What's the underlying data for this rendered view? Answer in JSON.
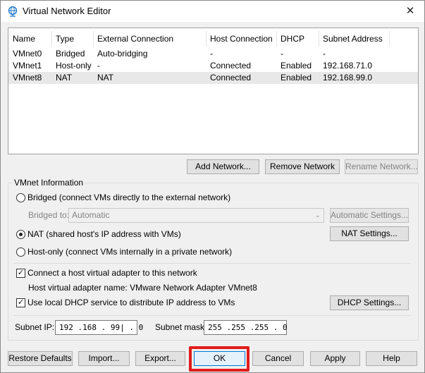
{
  "window": {
    "title": "Virtual Network Editor",
    "close_glyph": "✕"
  },
  "table": {
    "columns": [
      "Name",
      "Type",
      "External Connection",
      "Host Connection",
      "DHCP",
      "Subnet Address"
    ],
    "rows": [
      [
        "VMnet0",
        "Bridged",
        "Auto-bridging",
        "-",
        "-",
        "-"
      ],
      [
        "VMnet1",
        "Host-only",
        "-",
        "Connected",
        "Enabled",
        "192.168.71.0"
      ],
      [
        "VMnet8",
        "NAT",
        "NAT",
        "Connected",
        "Enabled",
        "192.168.99.0"
      ]
    ],
    "selected_row": 2
  },
  "network_buttons": {
    "add": "Add Network...",
    "remove": "Remove Network",
    "rename": "Rename Network..."
  },
  "vmnet_info": {
    "group_title": "VMnet Information",
    "bridged_label": "Bridged (connect VMs directly to the external network)",
    "bridged_to_label": "Bridged to:",
    "bridged_to_value": "Automatic",
    "auto_settings_button": "Automatic Settings...",
    "nat_label": "NAT (shared host's IP address with VMs)",
    "nat_settings_button": "NAT Settings...",
    "hostonly_label": "Host-only (connect VMs internally in a private network)",
    "selected_mode": "nat",
    "connect_adapter_label": "Connect a host virtual adapter to this network",
    "connect_adapter_checked": true,
    "adapter_name_text": "Host virtual adapter name: VMware Network Adapter VMnet8",
    "dhcp_label": "Use local DHCP service to distribute IP address to VMs",
    "dhcp_checked": true,
    "dhcp_settings_button": "DHCP Settings...",
    "subnet_ip_label": "Subnet IP:",
    "subnet_ip_value": "192 .168 . 99| . 0",
    "subnet_mask_label": "Subnet mask:",
    "subnet_mask_value": "255 .255 .255 . 0"
  },
  "footer_buttons": {
    "restore": "Restore Defaults",
    "import": "Import...",
    "export": "Export...",
    "ok": "OK",
    "cancel": "Cancel",
    "apply": "Apply",
    "help": "Help"
  },
  "colors": {
    "highlight": "#e21b1b",
    "selected_row": "#e8e8e8",
    "accent": "#0078d7"
  },
  "icons": {
    "title": "network-globe-icon",
    "combo_arrow": "chevron-down-icon"
  }
}
